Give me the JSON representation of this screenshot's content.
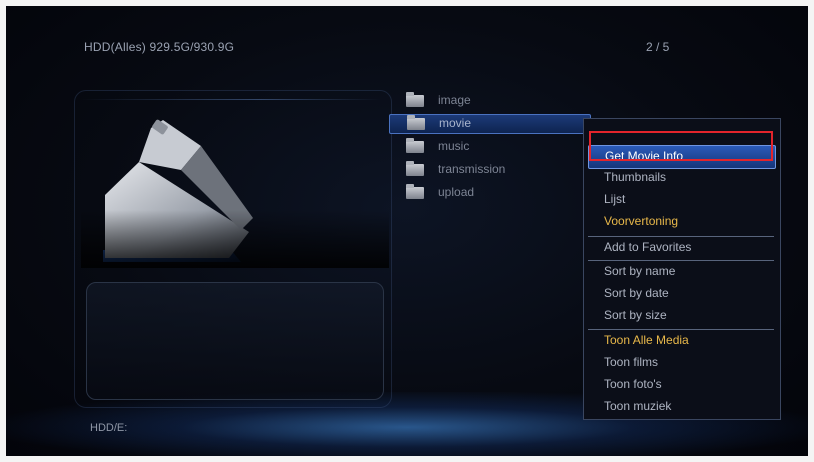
{
  "header": {
    "storage_info": "HDD(Alles) 929.5G/930.9G",
    "page_indicator": "2 / 5"
  },
  "files": {
    "items": [
      {
        "label": "image",
        "icon": "folder-icon"
      },
      {
        "label": "movie",
        "icon": "folder-icon",
        "selected": true
      },
      {
        "label": "music",
        "icon": "folder-icon"
      },
      {
        "label": "transmission",
        "icon": "folder-icon"
      },
      {
        "label": "upload",
        "icon": "folder-icon"
      }
    ]
  },
  "context_menu": {
    "items": [
      {
        "label": "Get Movie Info",
        "focused": true
      },
      {
        "label": "Thumbnails"
      },
      {
        "label": "Lijst"
      },
      {
        "label": "Voorvertoning",
        "accent": true
      },
      {
        "label": "Add to Favorites"
      },
      {
        "label": "Sort by name"
      },
      {
        "label": "Sort by date"
      },
      {
        "label": "Sort by size"
      },
      {
        "label": "Toon Alle Media",
        "accent": true
      },
      {
        "label": "Toon films"
      },
      {
        "label": "Toon foto's"
      },
      {
        "label": "Toon muziek"
      }
    ]
  },
  "footer": {
    "path": "HDD/E:"
  },
  "colors": {
    "accent": "#e8b84a",
    "highlight": "#2a5ab8",
    "annotation": "#e3242b"
  }
}
